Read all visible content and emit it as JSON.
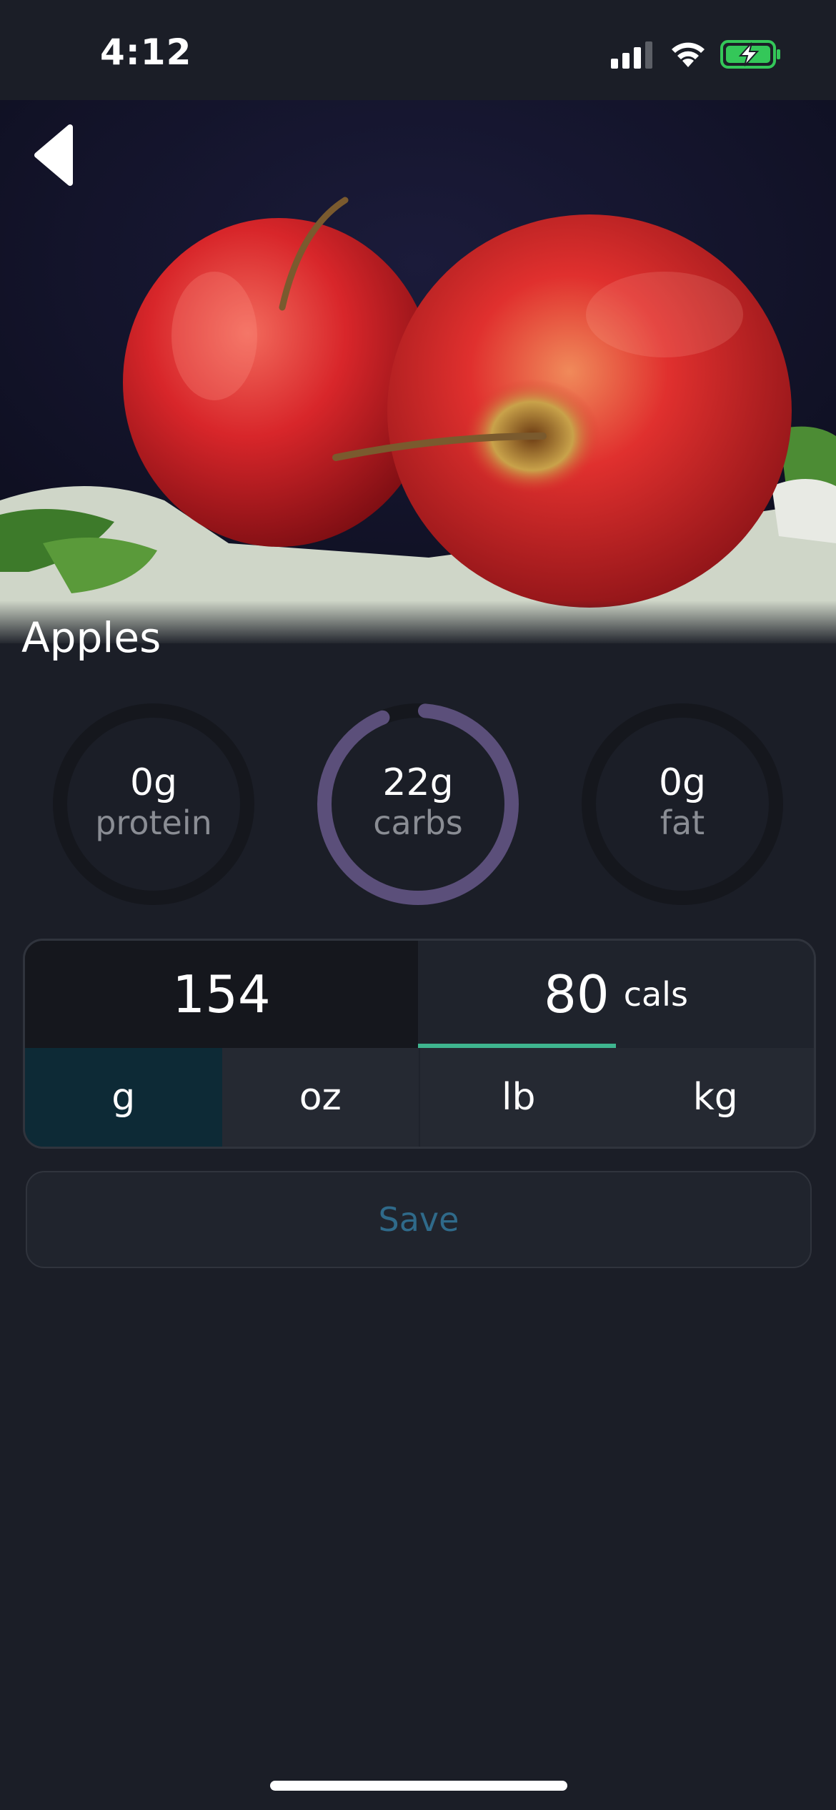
{
  "status_bar": {
    "time": "4:12",
    "signal_icon": "cellular-signal-icon",
    "wifi_icon": "wifi-icon",
    "battery_icon": "battery-charging-icon",
    "battery_color": "#34c759"
  },
  "food": {
    "name": "Apples",
    "image_icon": "apples-photo"
  },
  "nav": {
    "back_icon": "back-arrow-icon"
  },
  "macros": [
    {
      "value": "0",
      "unit": "g",
      "label": "protein",
      "fraction": 0
    },
    {
      "value": "22",
      "unit": "g",
      "label": "carbs",
      "fraction": 0.95
    },
    {
      "value": "0",
      "unit": "g",
      "label": "fat",
      "fraction": 0
    }
  ],
  "quantity": {
    "amount": "154",
    "calories": "80",
    "calories_unit": "cals",
    "calories_progress": 0.5
  },
  "units": {
    "options": [
      "g",
      "oz",
      "lb",
      "kg"
    ],
    "selected": "g"
  },
  "actions": {
    "save_label": "Save"
  },
  "colors": {
    "background": "#1b1e27",
    "ring_track": "#15171d",
    "carbs_ring": "#5b4f7a",
    "progress_accent": "#3fb58f",
    "selected_unit": "#0d2a36",
    "save_text": "#2f6a8a"
  }
}
